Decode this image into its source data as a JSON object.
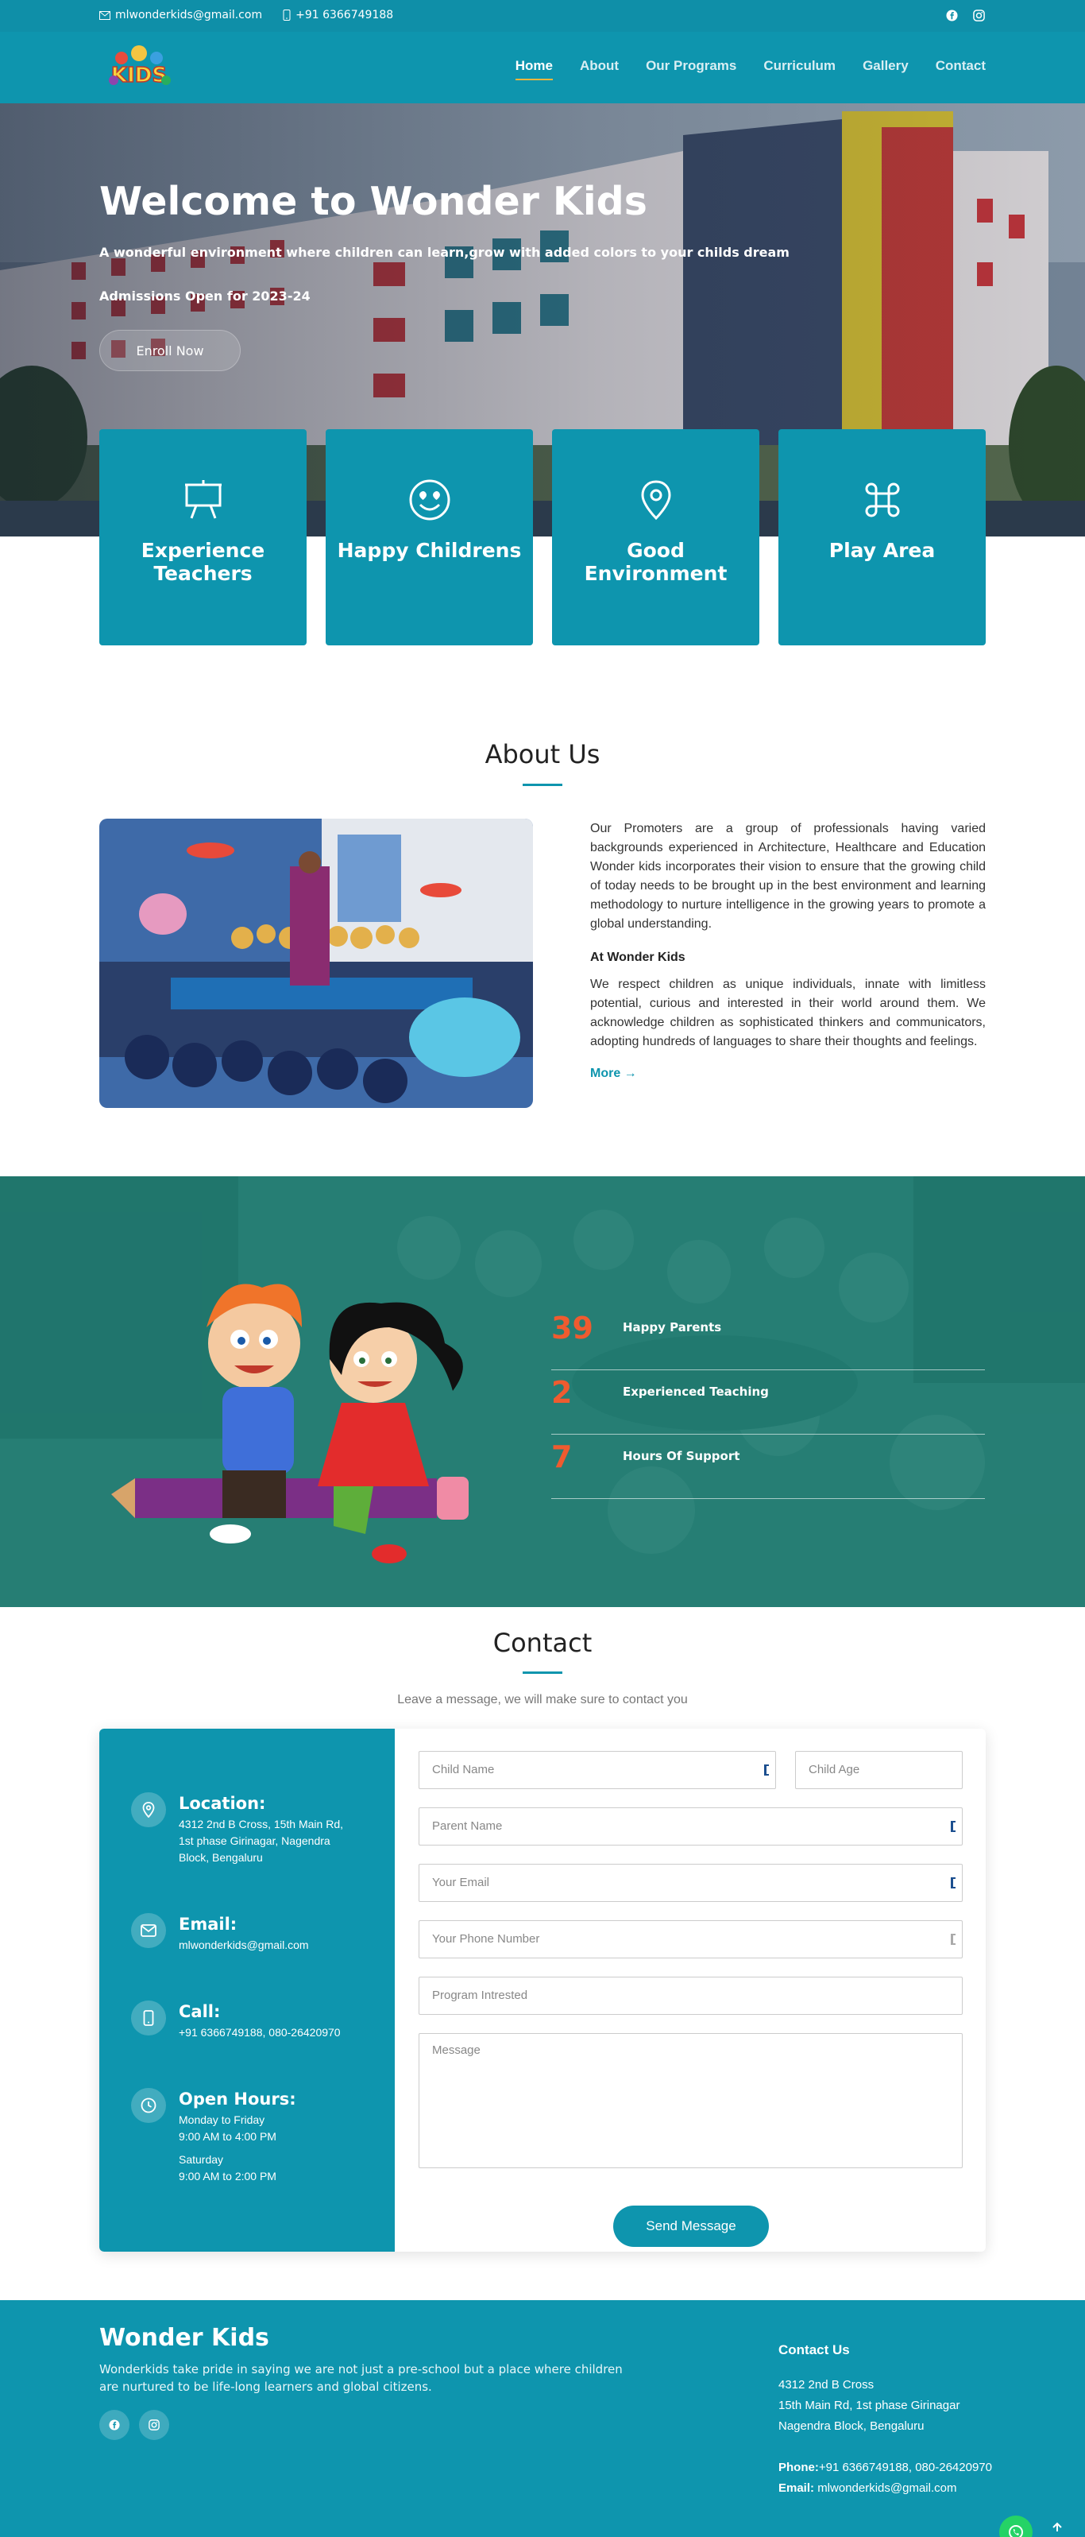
{
  "topbar": {
    "email": "mlwonderkids@gmail.com",
    "phone": "+91 6366749188",
    "icons": [
      "facebook-icon",
      "instagram-icon"
    ]
  },
  "header": {
    "logo_text": "KIDS",
    "nav": [
      "Home",
      "About",
      "Our Programs",
      "Curriculum",
      "Gallery",
      "Contact"
    ],
    "active_nav": "Home"
  },
  "hero": {
    "title": "Welcome to Wonder Kids",
    "subtitle": "A wonderful environment where children can learn,grow with added colors to your childs dream",
    "admissions": "Admissions Open for 2023-24",
    "cta": "Enroll Now"
  },
  "features": [
    {
      "title": "Experience Teachers",
      "icon": "easel-icon"
    },
    {
      "title": "Happy Childrens",
      "icon": "smile-icon"
    },
    {
      "title": "Good Environment",
      "icon": "location-pin-icon"
    },
    {
      "title": "Play Area",
      "icon": "command-icon"
    }
  ],
  "about": {
    "title": "About Us",
    "para1": "Our Promoters are a group of professionals having varied backgrounds experienced in Architecture, Healthcare and Education Wonder kids incorporates their vision to ensure that the growing child of today needs to be brought up in the best environment and learning methodology to nurture intelligence in the growing years to promote a global understanding.",
    "heading2": "At Wonder Kids",
    "para2": "We respect children as unique individuals, innate with limitless potential, curious and interested in their world around them. We acknowledge children as sophisticated thinkers and communicators, adopting hundreds of languages to share their thoughts and feelings.",
    "more": "More →"
  },
  "stats": [
    {
      "value": "39",
      "label": "Happy Parents"
    },
    {
      "value": "2",
      "label": "Experienced Teaching"
    },
    {
      "value": "7",
      "label": "Hours Of Support"
    }
  ],
  "contact": {
    "title": "Contact",
    "subtitle": "Leave a message, we will make sure to contact you",
    "info": [
      {
        "title": "Location:",
        "lines": "4312 2nd B Cross, 15th Main Rd, 1st phase Girinagar, Nagendra Block, Bengaluru",
        "icon": "location-icon"
      },
      {
        "title": "Email:",
        "lines": "mlwonderkids@gmail.com",
        "icon": "mail-icon"
      },
      {
        "title": "Call:",
        "lines": "+91 6366749188, 080-26420970",
        "icon": "phone-icon"
      },
      {
        "title": "Open Hours:",
        "lines": "Monday to Friday",
        "lines2": "9:00 AM to 4:00 PM",
        "lines3": "Saturday",
        "lines4": "9:00 AM to 2:00 PM",
        "icon": "clock-icon"
      }
    ],
    "form": {
      "child_name": "Child Name",
      "child_age": "Child Age",
      "parent_name": "Parent Name",
      "email": "Your Email",
      "phone": "Your Phone Number",
      "program": "Program Intrested",
      "message": "Message",
      "submit": "Send Message"
    }
  },
  "footer": {
    "brand": "Wonder Kids",
    "description": "Wonderkids take pride in saying we are not just a pre-school but a place where children are nurtured to be life-long learners and global citizens.",
    "contact_heading": "Contact Us",
    "address1": "4312 2nd B Cross",
    "address2": "15th Main Rd, 1st phase Girinagar",
    "address3": "Nagendra Block, Bengaluru",
    "phone_label": "Phone:",
    "phone": "+91 6366749188, 080-26420970",
    "email_label": "Email:",
    "email": "mlwonderkids@gmail.com"
  },
  "colors": {
    "primary": "#0e95ae",
    "accent": "#ef5b2f",
    "nav_underline": "#f4b63c"
  }
}
